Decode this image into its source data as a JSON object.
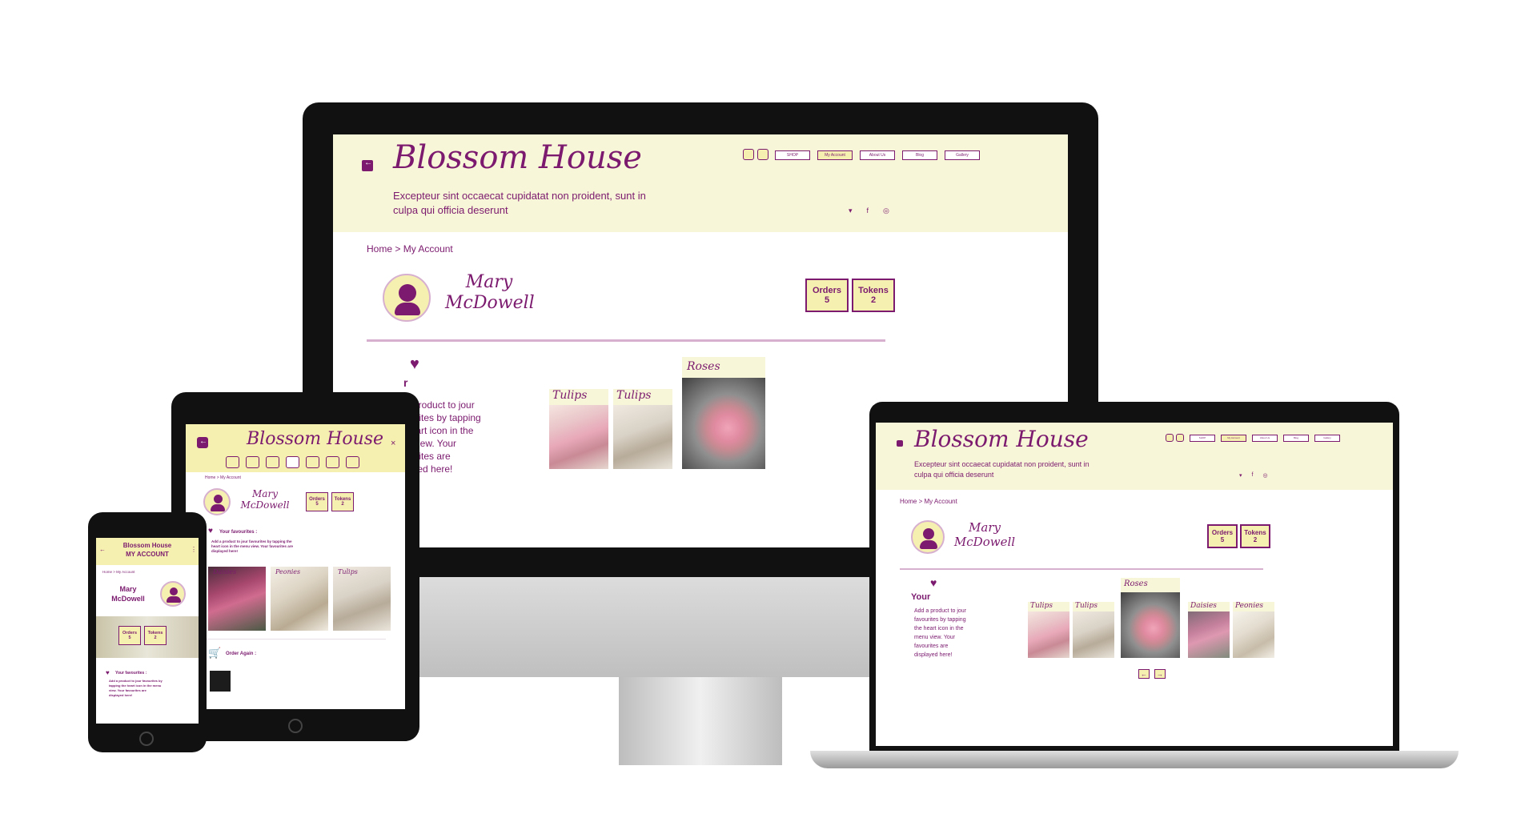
{
  "brand": {
    "name": "Blossom House",
    "tagline_line1": "Excepteur sint occaecat cupidatat non proident, sunt in",
    "tagline_line2": "culpa qui officia deserunt",
    "tagline_short1": "Excepteur sint occaecat cupidatat non proident, sunt in",
    "tagline_short2": "culpa qui officia deserunt"
  },
  "nav": [
    "SHOP",
    "My Account",
    "About Us",
    "Blog",
    "Gallery"
  ],
  "breadcrumb": {
    "home": "Home",
    "sep": ">",
    "current": "My Account",
    "mini": "Home > My Account"
  },
  "user": {
    "first": "Mary",
    "last": "McDowell"
  },
  "stats": {
    "orders_label": "Orders",
    "orders_value": "5",
    "tokens_label": "Tokens",
    "tokens_value": "2"
  },
  "favourites": {
    "heading": "Your",
    "heading_full": "Your favourites :",
    "desc_lines": [
      "Add a product to jour",
      "favourites by tapping",
      "the heart icon in the",
      "menu view. Your",
      "favourites are",
      "displayed here!"
    ],
    "monitor_lines": [
      "a product to jour",
      "ourites by tapping",
      "heart icon in the",
      "u view. Your",
      "ourites are",
      "layed here!"
    ],
    "monitor_heading": "r",
    "tablet_desc": [
      "Add a product to jour favourites by tapping the",
      "heart icon in the menu view. Your favourites are",
      "displayed here!"
    ],
    "phone_desc": [
      "Add a product to jour favourites by",
      "tapping the heart icon in the menu",
      "view. Your favourites are",
      "displayed here!"
    ]
  },
  "products": {
    "tulips": "Tulips",
    "roses": "Roses",
    "daisies": "Daisies",
    "peonies": "Peonies"
  },
  "order_again": "Order Again :",
  "phone_header": {
    "line1": "Blossom House",
    "line2": "MY ACCOUNT"
  },
  "icons": {
    "back": "arrow-left-icon",
    "home": "home-icon",
    "search": "search-icon",
    "twitter": "twitter-icon",
    "facebook": "facebook-icon",
    "instagram": "instagram-icon",
    "heart": "heart-icon",
    "cart": "cart-icon",
    "user": "user-icon",
    "close": "close-icon",
    "menu": "more-vertical-icon",
    "prev": "arrow-left-icon",
    "next": "arrow-right-icon"
  },
  "colors": {
    "plum": "#7b1a6e",
    "cream": "#f8f6d8",
    "butter": "#f6f0b0",
    "lilac": "#d7b0cf"
  }
}
